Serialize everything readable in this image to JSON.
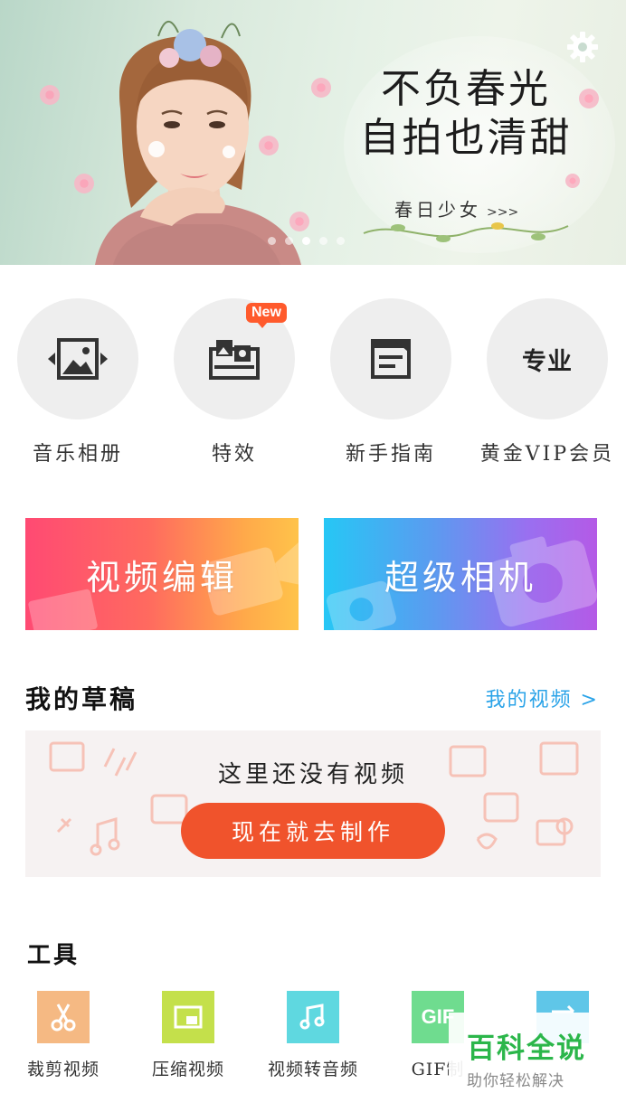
{
  "banner": {
    "headline1": "不负春光",
    "headline2": "自拍也清甜",
    "subline": "春日少女",
    "subline_arrows": ">>>",
    "dots": 5,
    "active_dot": 3
  },
  "quick_actions": [
    {
      "label": "音乐相册",
      "icon": "photo-slides-icon"
    },
    {
      "label": "特效",
      "icon": "effects-icon",
      "badge": "New"
    },
    {
      "label": "新手指南",
      "icon": "guide-icon"
    },
    {
      "label": "黄金VIP会员",
      "icon": "vip-pro-icon",
      "icon_text": "专业"
    }
  ],
  "cards": {
    "video_edit": "视频编辑",
    "super_camera": "超级相机"
  },
  "drafts": {
    "title": "我的草稿",
    "my_videos_link": "我的视频 >",
    "empty_text": "这里还没有视频",
    "cta": "现在就去制作"
  },
  "tools": {
    "title": "工具",
    "items": [
      {
        "label": "裁剪视频",
        "icon": "scissors-icon",
        "color": "#f5b983"
      },
      {
        "label": "压缩视频",
        "icon": "compress-icon",
        "color": "#c4e04b"
      },
      {
        "label": "视频转音频",
        "icon": "music-note-icon",
        "color": "#5fd8e0"
      },
      {
        "label": "GIF制",
        "icon": "gif-icon",
        "icon_text": "GIF",
        "color": "#6fdc8f"
      },
      {
        "label": "",
        "icon": "convert-icon",
        "color": "#5fc6e8"
      }
    ]
  },
  "watermark": {
    "brand": "百科全说",
    "tagline": "助你轻松解决"
  }
}
